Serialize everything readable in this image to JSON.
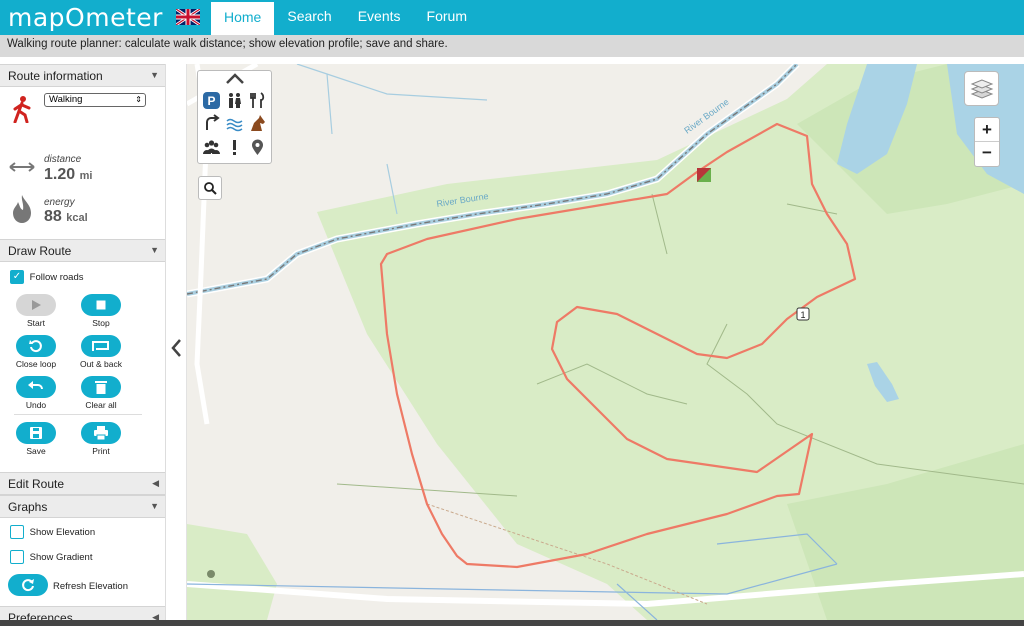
{
  "header": {
    "logo": "mapOmeter",
    "nav": [
      "Home",
      "Search",
      "Events",
      "Forum"
    ],
    "active": "Home"
  },
  "subbar": "Walking route planner: calculate walk distance; show elevation profile; save and share.",
  "route_info": {
    "title": "Route information",
    "activity": "Walking",
    "distance_label": "distance",
    "distance_value": "1.20",
    "distance_unit": "mi",
    "energy_label": "energy",
    "energy_value": "88",
    "energy_unit": "kcal"
  },
  "draw_route": {
    "title": "Draw Route",
    "follow_roads": "Follow roads",
    "start": "Start",
    "stop": "Stop",
    "close_loop": "Close loop",
    "out_back": "Out & back",
    "undo": "Undo",
    "clear_all": "Clear all",
    "save": "Save",
    "print": "Print"
  },
  "edit_route": {
    "title": "Edit Route"
  },
  "graphs": {
    "title": "Graphs",
    "show_elevation": "Show Elevation",
    "show_gradient": "Show Gradient",
    "refresh_elevation": "Refresh Elevation"
  },
  "preferences": {
    "title": "Preferences"
  },
  "map": {
    "river_label_1": "River Bourne",
    "river_label_2": "River Bourne",
    "mile_marker": "1",
    "zoom_in": "+",
    "zoom_out": "−",
    "colors": {
      "route": "#ee7a66",
      "park": "#d9ecc6",
      "water": "#aad3e6",
      "brand": "#12aecd"
    }
  }
}
